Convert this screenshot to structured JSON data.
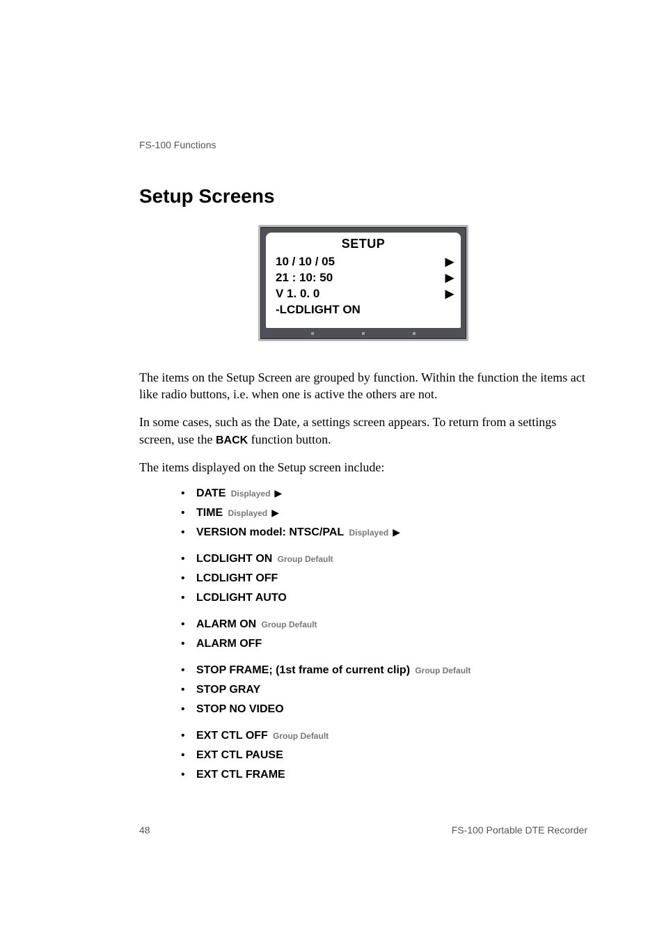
{
  "header": {
    "running": "FS-100 Functions"
  },
  "title": "Setup Screens",
  "lcd": {
    "title": "SETUP",
    "line1": "10 / 10 / 05",
    "line2": "21 : 10: 50",
    "line3": "V  1. 0. 0",
    "line4": "-LCDLIGHT   ON"
  },
  "para1": "The items on the Setup Screen are grouped by function. Within the function the items act like radio buttons, i.e. when one is active the others are not.",
  "para2a": "In some cases, such as the Date, a settings screen appears. To return from a settings screen, use the ",
  "para2key": "BACK",
  "para2b": " function button.",
  "para3": "The items displayed on the Setup screen include:",
  "items": [
    {
      "main": "DATE",
      "note": "Displayed",
      "tri": true,
      "gap": false
    },
    {
      "main": "TIME",
      "note": "Displayed",
      "tri": true,
      "gap": false
    },
    {
      "main": "VERSION model: NTSC/PAL",
      "note": "Displayed",
      "tri": true,
      "gap": false
    },
    {
      "main": "LCDLIGHT ON",
      "note": "Group Default",
      "tri": false,
      "gap": true
    },
    {
      "main": "LCDLIGHT OFF",
      "note": "",
      "tri": false,
      "gap": false
    },
    {
      "main": "LCDLIGHT AUTO",
      "note": "",
      "tri": false,
      "gap": false
    },
    {
      "main": "ALARM ON",
      "note": "Group Default",
      "tri": false,
      "gap": true
    },
    {
      "main": "ALARM OFF",
      "note": "",
      "tri": false,
      "gap": false
    },
    {
      "main": "STOP FRAME; (1st frame of current clip)",
      "note": "Group Default",
      "tri": false,
      "gap": true
    },
    {
      "main": "STOP GRAY",
      "note": "",
      "tri": false,
      "gap": false
    },
    {
      "main": "STOP NO VIDEO",
      "note": "",
      "tri": false,
      "gap": false
    },
    {
      "main": "EXT CTL OFF",
      "note": "Group Default",
      "tri": false,
      "gap": true
    },
    {
      "main": "EXT CTL PAUSE",
      "note": "",
      "tri": false,
      "gap": false
    },
    {
      "main": "EXT CTL FRAME",
      "note": "",
      "tri": false,
      "gap": false
    }
  ],
  "footer": {
    "page": "48",
    "doc": "FS-100 Portable DTE Recorder"
  }
}
